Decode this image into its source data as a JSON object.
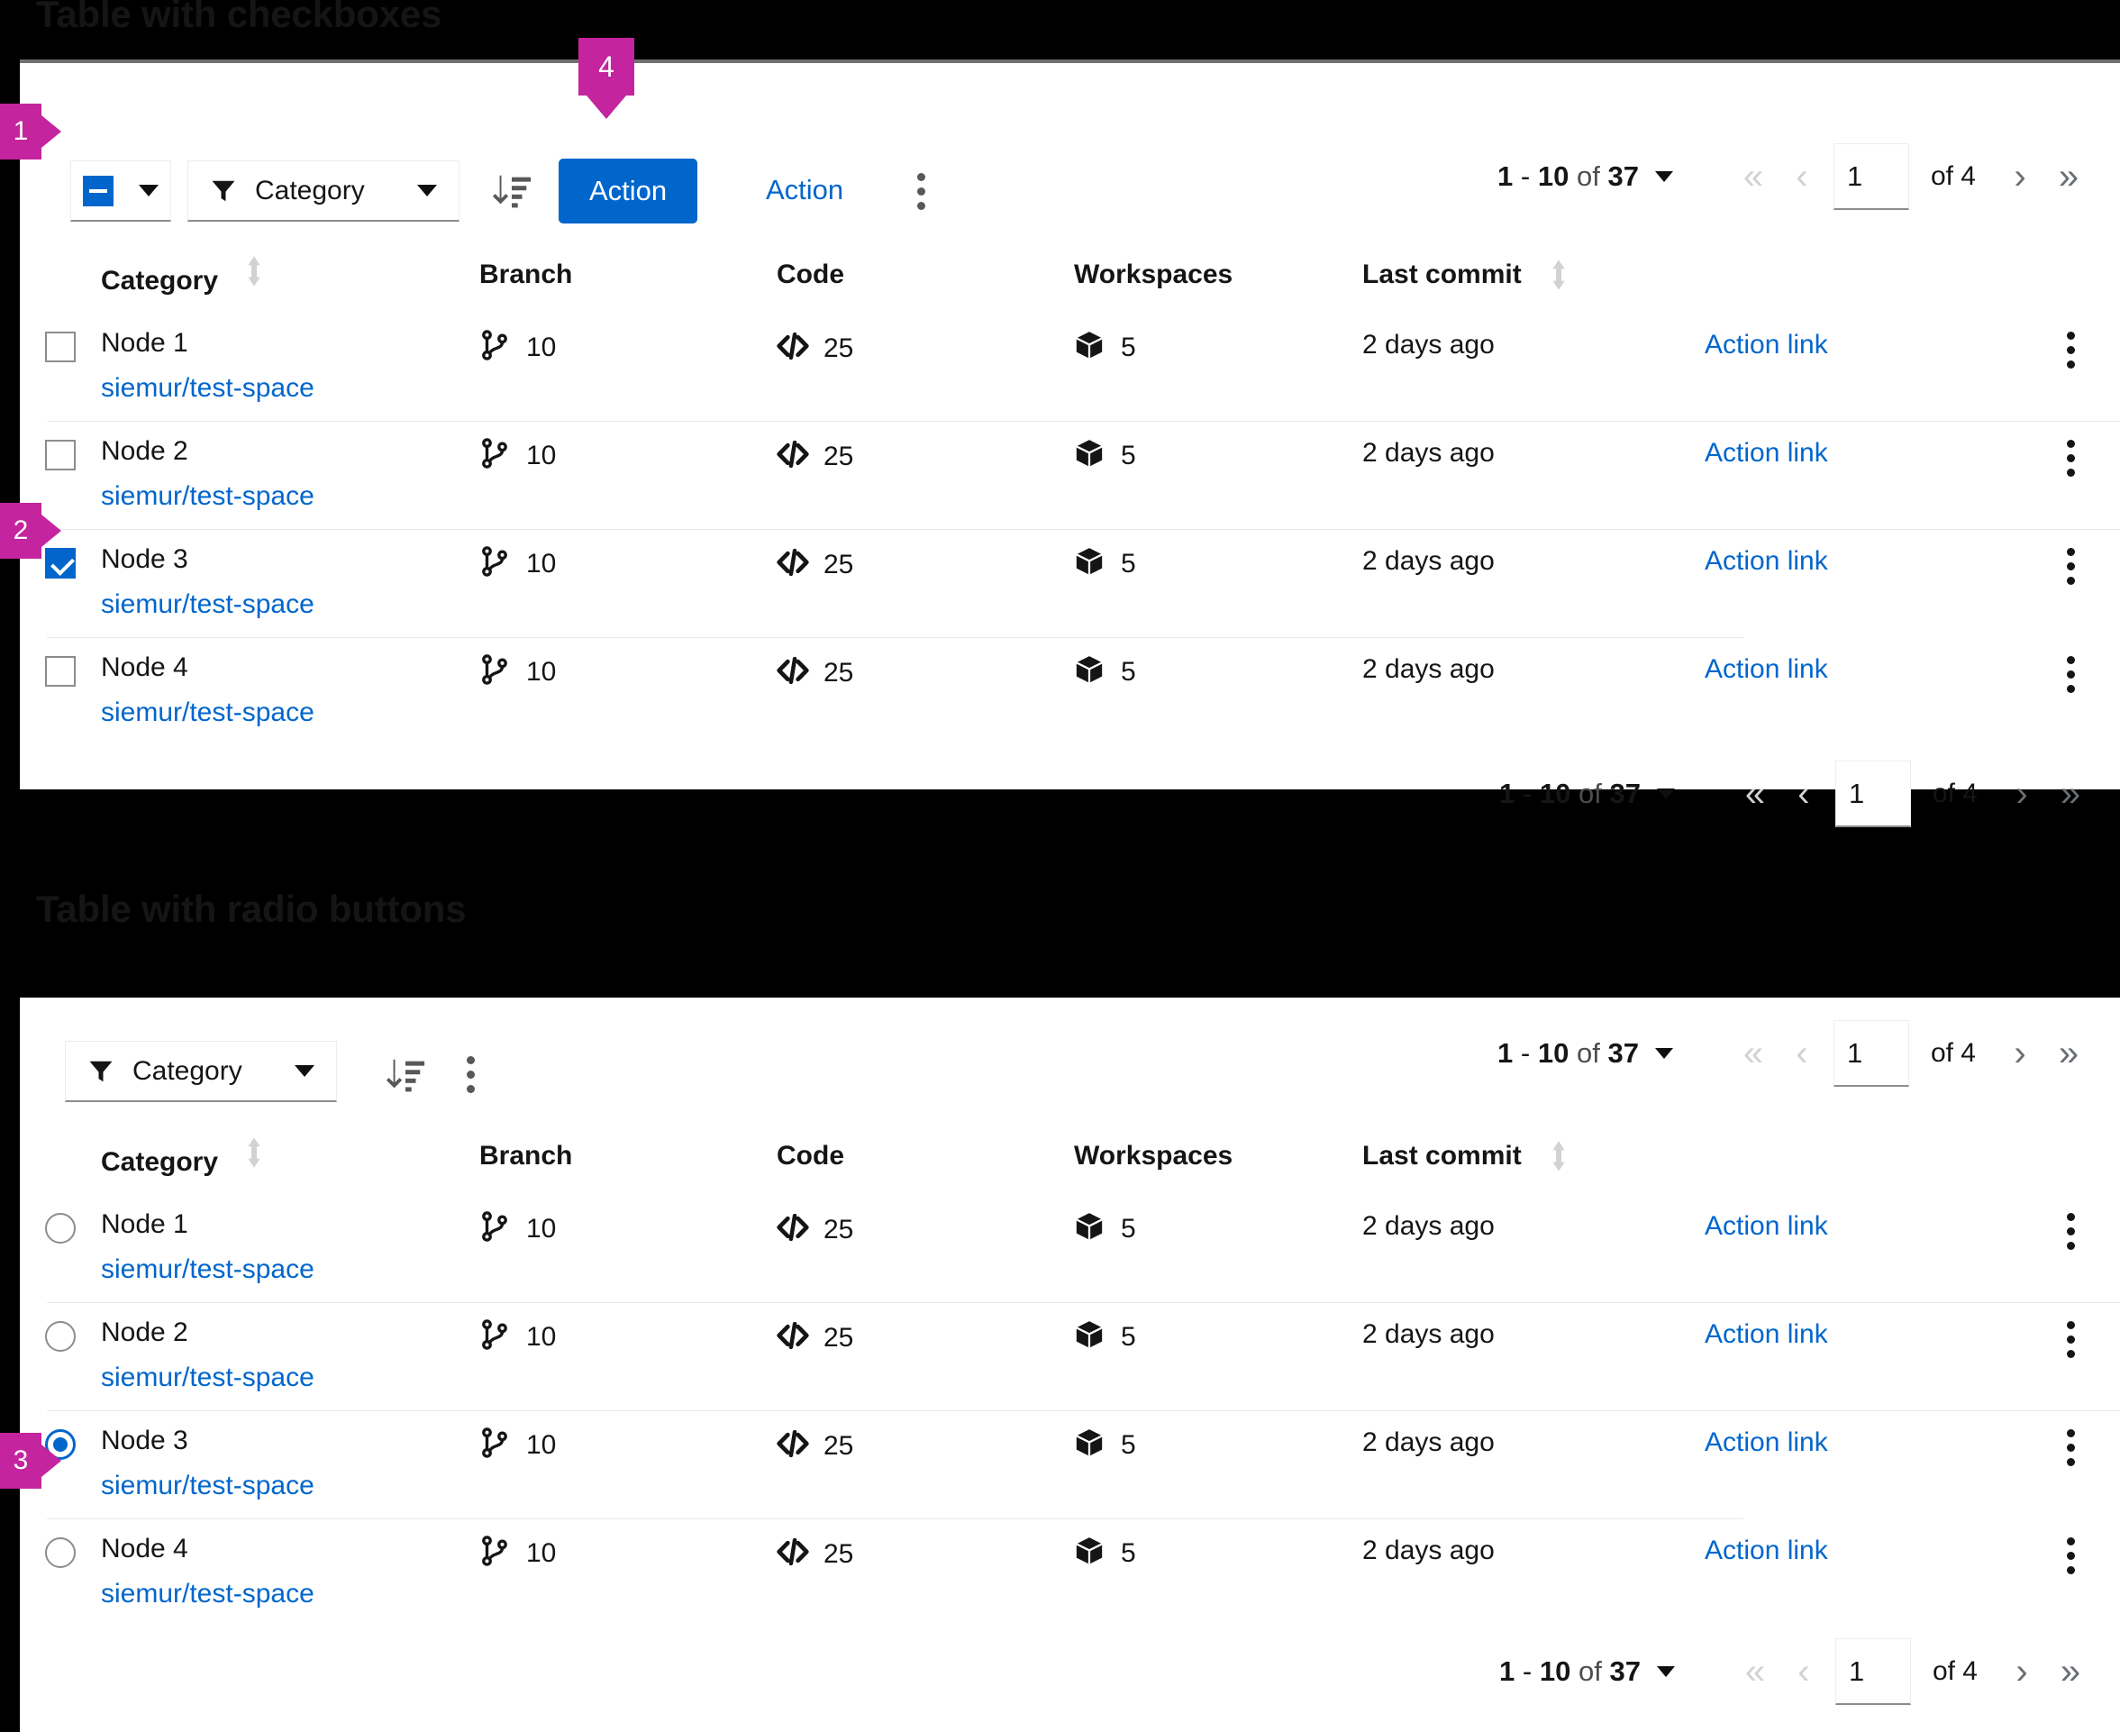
{
  "sections": {
    "checkbox_title": "Table with checkboxes",
    "radio_title": "Table with radio buttons"
  },
  "colors": {
    "accent_blue": "#0066CC",
    "link_blue": "#0066CC",
    "annotation_magenta": "#C4249E",
    "text": "#151515",
    "muted": "#6A6E73",
    "disabled_arrow": "#D2D2D2",
    "page_background": "#000000",
    "card_background": "#FFFFFF"
  },
  "toolbar_checkbox": {
    "bulk_select_state": "indeterminate",
    "bulk_select_icon": "checkbox-indeterminate-icon",
    "bulk_select_caret_icon": "caret-down-icon",
    "filter_icon": "filter-funnel-icon",
    "filter_label": "Category",
    "filter_caret_icon": "caret-down-icon",
    "sort_icon": "sort-amount-down-icon",
    "primary_action_label": "Action",
    "secondary_action_label": "Action",
    "kebab_icon": "kebab-vertical-icon"
  },
  "toolbar_radio": {
    "filter_icon": "filter-funnel-icon",
    "filter_label": "Category",
    "filter_caret_icon": "caret-down-icon",
    "sort_icon": "sort-amount-down-icon",
    "kebab_icon": "kebab-vertical-icon"
  },
  "pagination": {
    "range_start": "1",
    "range_separator": "-",
    "range_end": "10",
    "of_word": "of",
    "total": "37",
    "caret_icon": "caret-down-icon",
    "first_icon": "angle-double-left-icon",
    "prev_icon": "angle-left-icon",
    "page_value": "1",
    "page_of_label": "of 4",
    "next_icon": "angle-right-icon",
    "last_icon": "angle-double-right-icon"
  },
  "table": {
    "columns": [
      {
        "label": "Category",
        "sortable": true,
        "sort_icon": "sort-updown-icon"
      },
      {
        "label": "Branch",
        "sortable": false
      },
      {
        "label": "Code",
        "sortable": false
      },
      {
        "label": "Workspaces",
        "sortable": false
      },
      {
        "label": "Last commit",
        "sortable": true,
        "sort_icon": "sort-updown-icon"
      }
    ],
    "icons": {
      "branch": "code-branch-icon",
      "code": "code-icon",
      "workspaces": "cube-icon",
      "row_menu": "kebab-vertical-icon"
    },
    "rows": [
      {
        "name": "Node 1",
        "repo": "siemur/test-space",
        "branch": "10",
        "code": "25",
        "workspaces": "5",
        "last_commit": "2 days ago",
        "action": "Action link",
        "checkbox_selected": false,
        "radio_selected": false
      },
      {
        "name": "Node 2",
        "repo": "siemur/test-space",
        "branch": "10",
        "code": "25",
        "workspaces": "5",
        "last_commit": "2 days ago",
        "action": "Action link",
        "checkbox_selected": false,
        "radio_selected": false
      },
      {
        "name": "Node 3",
        "repo": "siemur/test-space",
        "branch": "10",
        "code": "25",
        "workspaces": "5",
        "last_commit": "2 days ago",
        "action": "Action link",
        "checkbox_selected": true,
        "radio_selected": true
      },
      {
        "name": "Node 4",
        "repo": "siemur/test-space",
        "branch": "10",
        "code": "25",
        "workspaces": "5",
        "last_commit": "2 days ago",
        "action": "Action link",
        "checkbox_selected": false,
        "radio_selected": false
      }
    ]
  },
  "annotations": [
    {
      "number": "1",
      "target": "bulk-select-checkbox",
      "direction": "right"
    },
    {
      "number": "2",
      "target": "row-checkbox-node-3",
      "direction": "right"
    },
    {
      "number": "3",
      "target": "row-radio-node-3",
      "direction": "right"
    },
    {
      "number": "4",
      "target": "primary-action-button",
      "direction": "down"
    }
  ]
}
